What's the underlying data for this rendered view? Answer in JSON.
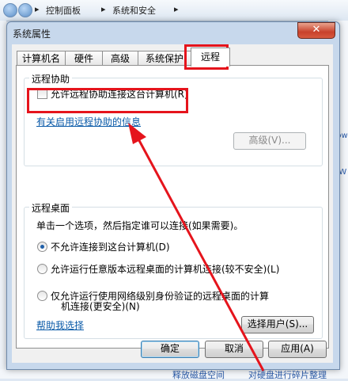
{
  "explorer": {
    "breadcrumb": [
      "控制面板",
      "系统和安全"
    ],
    "right_fragments": [
      "改",
      "dow",
      "e W"
    ],
    "bottom_fragments": [
      "释放磁盘空间",
      "对硬盘进行碎片整理"
    ]
  },
  "dialog": {
    "title": "系统属性",
    "close_glyph": "✕",
    "tabs": [
      "计算机名",
      "硬件",
      "高级",
      "系统保护",
      "远程"
    ],
    "active_tab": "远程",
    "remote_assistance": {
      "group_title": "远程协助",
      "allow_checkbox_label": "允许远程协助连接这台计算机(R)",
      "allow_checked": false,
      "info_link": "有关启用远程协助的信息",
      "advanced_button": "高级(V)..."
    },
    "remote_desktop": {
      "group_title": "远程桌面",
      "instruction": "单击一个选项，然后指定谁可以连接(如果需要)。",
      "options": [
        {
          "label": "不允许连接到这台计算机(D)",
          "selected": true
        },
        {
          "label": "允许运行任意版本远程桌面的计算机连接(较不安全)(L)",
          "selected": false
        },
        {
          "label": "仅允许运行使用网络级别身份验证的远程桌面的计算机连接(更安全)(N)",
          "line1": "仅允许运行使用网络级别身份验证的远程桌面的计算",
          "line2": "机连接(更安全)(N)",
          "selected": false
        }
      ],
      "help_link": "帮助我选择",
      "select_users_button": "选择用户(S)..."
    },
    "footer": {
      "ok": "确定",
      "cancel": "取消",
      "apply": "应用(A)"
    }
  }
}
